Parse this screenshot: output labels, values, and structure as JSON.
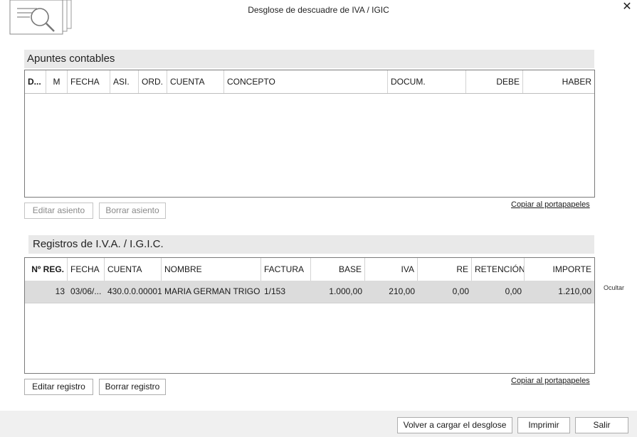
{
  "window": {
    "title": "Desglose de descuadre de IVA / IGIC",
    "close_glyph": "✕"
  },
  "apuntes": {
    "title": "Apuntes contables",
    "columns": [
      "D...",
      "M",
      "FECHA",
      "ASI.",
      "ORD.",
      "CUENTA",
      "CONCEPTO",
      "DOCUM.",
      "DEBE",
      "HABER"
    ],
    "rows": [],
    "edit_button": "Editar asiento",
    "delete_button": "Borrar asiento",
    "copy_link": "Copiar al portapapeles"
  },
  "registros": {
    "title": "Registros de I.V.A. / I.G.I.C.",
    "columns": [
      "Nº REG.",
      "FECHA",
      "CUENTA",
      "NOMBRE",
      "FACTURA",
      "BASE",
      "IVA",
      "RE",
      "RETENCIÓN",
      "IMPORTE"
    ],
    "rows": [
      [
        "13",
        "03/06/...",
        "430.0.0.00001",
        "MARIA GERMAN TRIGO",
        "1/153",
        "1.000,00",
        "210,00",
        "0,00",
        "0,00",
        "1.210,00"
      ]
    ],
    "hide_link": "Ocultar",
    "edit_button": "Editar registro",
    "delete_button": "Borrar registro",
    "copy_link": "Copiar al portapapeles"
  },
  "footer": {
    "reload_button": "Volver a cargar el desglose",
    "print_button": "Imprimir",
    "exit_button": "Salir"
  },
  "icons": {
    "header_icon": "document-search-icon",
    "close": "close-icon"
  }
}
